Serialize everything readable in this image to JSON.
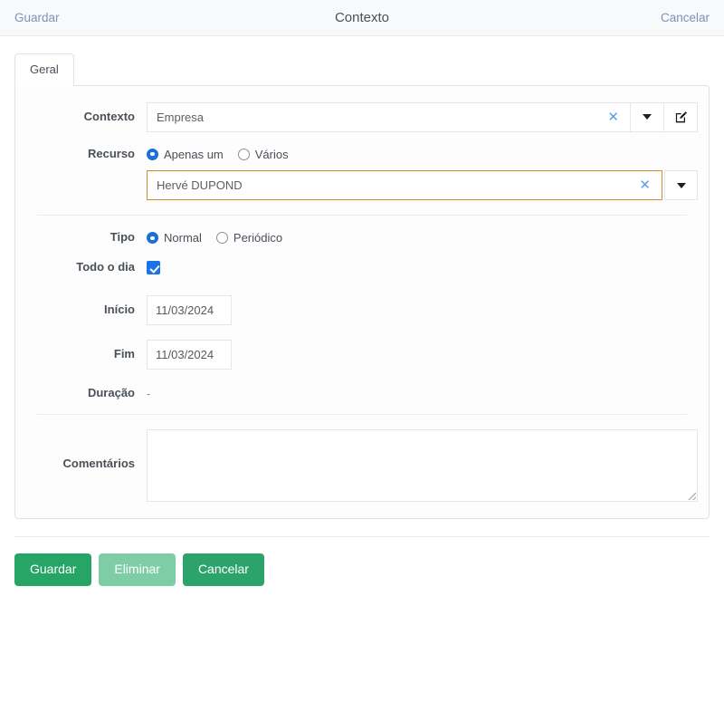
{
  "topbar": {
    "save_label": "Guardar",
    "title": "Contexto",
    "cancel_label": "Cancelar"
  },
  "tabs": [
    {
      "label": "Geral",
      "active": true
    }
  ],
  "form": {
    "contexto": {
      "label": "Contexto",
      "value": "Empresa",
      "clear_icon": "close-icon",
      "dropdown_icon": "chevron-down-icon",
      "edit_icon": "pencil-square-icon"
    },
    "recurso": {
      "label": "Recurso",
      "options": [
        {
          "label": "Apenas um",
          "selected": true
        },
        {
          "label": "Vários",
          "selected": false
        }
      ],
      "value": "Hervé DUPOND",
      "clear_icon": "close-icon",
      "dropdown_icon": "chevron-down-icon",
      "highlight_color": "#d88a2b"
    },
    "tipo": {
      "label": "Tipo",
      "options": [
        {
          "label": "Normal",
          "selected": true
        },
        {
          "label": "Periódico",
          "selected": false
        }
      ]
    },
    "todo_o_dia": {
      "label": "Todo o dia",
      "checked": true
    },
    "inicio": {
      "label": "Início",
      "value": "11/03/2024"
    },
    "fim": {
      "label": "Fim",
      "value": "11/03/2024"
    },
    "duracao": {
      "label": "Duração",
      "value": "-"
    },
    "comentarios": {
      "label": "Comentários",
      "value": "",
      "placeholder": ""
    }
  },
  "footer": {
    "buttons": [
      {
        "label": "Guardar",
        "style": "primary",
        "color": "#27a567"
      },
      {
        "label": "Eliminar",
        "style": "muted",
        "color": "#7fcda6"
      },
      {
        "label": "Cancelar",
        "style": "secondary",
        "color": "#2ba36a"
      }
    ]
  }
}
